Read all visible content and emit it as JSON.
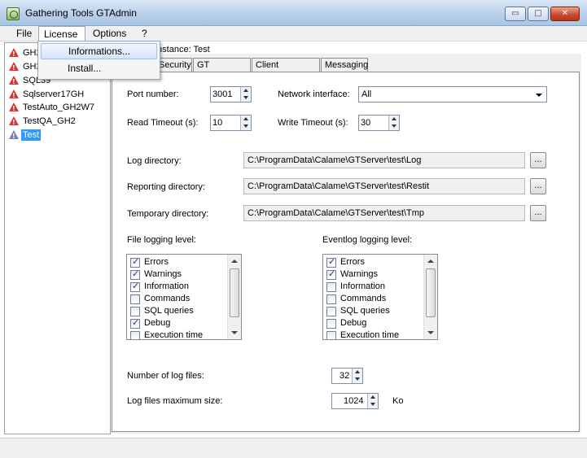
{
  "window": {
    "title": "Gathering Tools GTAdmin",
    "min": "▭",
    "max": "□",
    "close": "✕"
  },
  "menu": {
    "file": "File",
    "license": "License",
    "options": "Options",
    "help": "?"
  },
  "license_menu": {
    "items": [
      "Informations...",
      "Install..."
    ]
  },
  "instance_label": "Instance: Test",
  "tree": {
    "items": [
      "GH2",
      "GH2",
      "SQL39",
      "Sqlserver17GH",
      "TestAuto_GH2W7",
      "TestQA_GH2",
      "Test"
    ]
  },
  "tabs": [
    "Security",
    "GT database",
    "Client database",
    "Messaging"
  ],
  "form": {
    "port_label": "Port number:",
    "port_value": "3001",
    "iface_label": "Network interface:",
    "iface_value": "All",
    "read_timeout_label": "Read Timeout (s):",
    "read_timeout_value": "10",
    "write_timeout_label": "Write Timeout (s):",
    "write_timeout_value": "30",
    "log_dir_label": "Log directory:",
    "log_dir_value": "C:\\ProgramData\\Calame\\GTServer\\test\\Log",
    "rep_dir_label": "Reporting directory:",
    "rep_dir_value": "C:\\ProgramData\\Calame\\GTServer\\test\\Restit",
    "tmp_dir_label": "Temporary directory:",
    "tmp_dir_value": "C:\\ProgramData\\Calame\\GTServer\\test\\Tmp",
    "browse": "...",
    "file_level_label": "File logging level:",
    "event_level_label": "Eventlog logging level:",
    "num_logs_label": "Number of log files:",
    "num_logs_value": "32",
    "max_size_label": "Log files maximum size:",
    "max_size_value": "1024",
    "max_size_unit": "Ko"
  },
  "file_levels": [
    {
      "label": "Errors",
      "checked": true
    },
    {
      "label": "Warnings",
      "checked": true
    },
    {
      "label": "Information",
      "checked": true
    },
    {
      "label": "Commands",
      "checked": false
    },
    {
      "label": "SQL queries",
      "checked": false
    },
    {
      "label": "Debug",
      "checked": true
    },
    {
      "label": "Execution time",
      "checked": false
    }
  ],
  "event_levels": [
    {
      "label": "Errors",
      "checked": true
    },
    {
      "label": "Warnings",
      "checked": true
    },
    {
      "label": "Information",
      "checked": false
    },
    {
      "label": "Commands",
      "checked": false
    },
    {
      "label": "SQL queries",
      "checked": false
    },
    {
      "label": "Debug",
      "checked": false
    },
    {
      "label": "Execution time",
      "checked": false
    }
  ]
}
